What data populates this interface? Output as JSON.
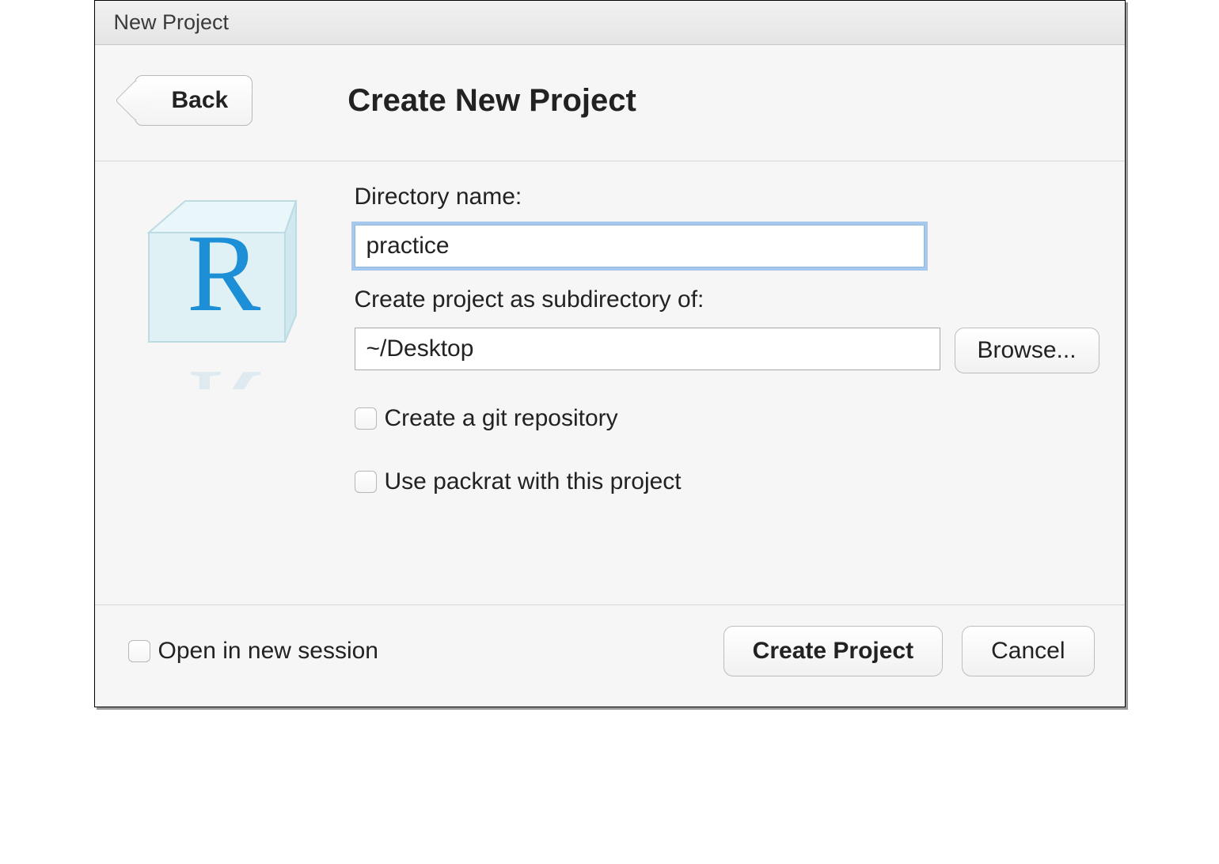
{
  "window": {
    "title": "New Project"
  },
  "header": {
    "back_label": "Back",
    "title": "Create New Project"
  },
  "form": {
    "dir_label": "Directory name:",
    "dir_value": "practice",
    "subdir_label": "Create project as subdirectory of:",
    "subdir_value": "~/Desktop",
    "browse_label": "Browse...",
    "git_label": "Create a git repository",
    "packrat_label": "Use packrat with this project"
  },
  "footer": {
    "open_new_session_label": "Open in new session",
    "create_label": "Create Project",
    "cancel_label": "Cancel"
  }
}
